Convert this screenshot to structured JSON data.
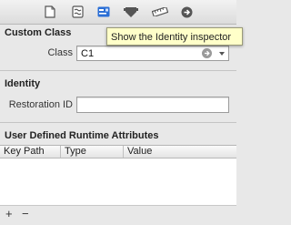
{
  "toolbar": {
    "icons": [
      {
        "name": "file-inspector-icon"
      },
      {
        "name": "quick-help-icon"
      },
      {
        "name": "identity-inspector-icon"
      },
      {
        "name": "attributes-inspector-icon"
      },
      {
        "name": "size-inspector-icon"
      },
      {
        "name": "connections-inspector-icon"
      }
    ],
    "tooltip": "Show the Identity inspector"
  },
  "custom_class": {
    "section_title": "Custom Class",
    "class_label": "Class",
    "class_value": "C1"
  },
  "identity": {
    "section_title": "Identity",
    "restoration_id_label": "Restoration ID",
    "restoration_id_value": ""
  },
  "runtime_attributes": {
    "section_title": "User Defined Runtime Attributes",
    "columns": [
      "Key Path",
      "Type",
      "Value"
    ],
    "rows": []
  },
  "footer": {
    "add_label": "+",
    "remove_label": "−"
  },
  "colors": {
    "selected_icon": "#2b6fd6",
    "tooltip_bg": "#ffffc9",
    "panel_bg": "#e8e8e8"
  }
}
